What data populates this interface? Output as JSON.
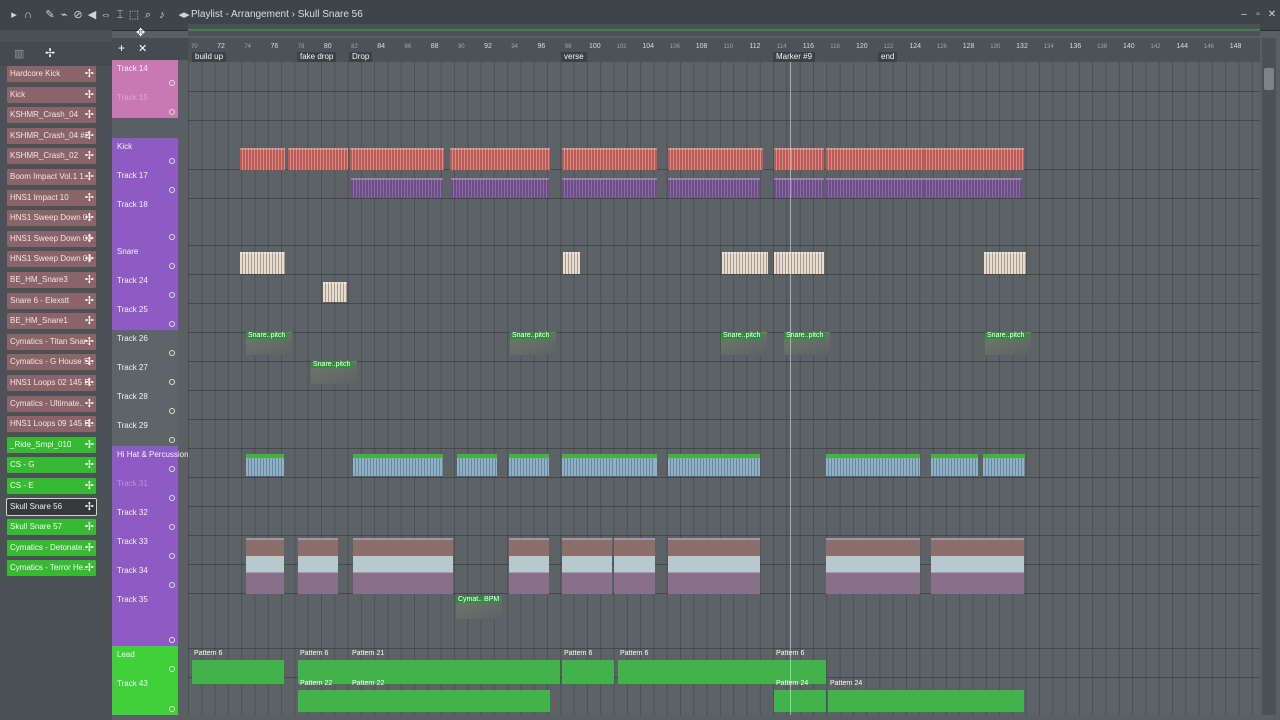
{
  "title": {
    "window": "Playlist",
    "separator": "-",
    "view": "Arrangement",
    "separator2": "›",
    "selected": "Skull Snare 56"
  },
  "colors": {
    "track_pink": "#c879b4",
    "track_purple": "#8d5bc3",
    "track_green": "#3fd03a",
    "accent_green": "#37b933"
  },
  "channels": [
    {
      "label": "Hardcore Kick",
      "color": "pink"
    },
    {
      "label": "Kick",
      "color": "pink"
    },
    {
      "label": "KSHMR_Crash_04",
      "color": "pink"
    },
    {
      "label": "KSHMR_Crash_04 #2",
      "color": "pink"
    },
    {
      "label": "KSHMR_Crash_02",
      "color": "pink"
    },
    {
      "label": "Boom Impact Vol.1 1..",
      "color": "pink"
    },
    {
      "label": "HNS1 Impact 10",
      "color": "pink"
    },
    {
      "label": "HNS1 Sweep Down 01",
      "color": "pink"
    },
    {
      "label": "HNS1 Sweep Down 03",
      "color": "pink"
    },
    {
      "label": "HNS1 Sweep Down 04",
      "color": "pink"
    },
    {
      "label": "BE_HM_Snare3",
      "color": "pink"
    },
    {
      "label": "Snare 6 - Elexstt",
      "color": "pink"
    },
    {
      "label": "BE_HM_Snare1",
      "color": "pink"
    },
    {
      "label": "Cymatics - Titan Snar..",
      "color": "pink"
    },
    {
      "label": "Cymatics - G House S..",
      "color": "pink"
    },
    {
      "label": "HNS1 Loops 02 145 B..",
      "color": "pink"
    },
    {
      "label": "Cymatics - Ultimate..",
      "color": "pink"
    },
    {
      "label": "HNS1 Loops 09 145 B..",
      "color": "pink"
    },
    {
      "label": "_Ride_Smpl_010",
      "color": "green"
    },
    {
      "label": "CS - G",
      "color": "green"
    },
    {
      "label": "CS - E",
      "color": "green"
    },
    {
      "label": "Skull Snare 56",
      "color": "sel"
    },
    {
      "label": "Skull Snare 57",
      "color": "green"
    },
    {
      "label": "Cymatics - Detonate..",
      "color": "green"
    },
    {
      "label": "Cymatics - Terror He..",
      "color": "green"
    }
  ],
  "tracks": [
    {
      "label": "Track 14",
      "color": "#c879b4"
    },
    {
      "label": "Track 15",
      "color": "#c879b4",
      "dim": true
    },
    {
      "label": "Kick",
      "color": "#8d5bc3"
    },
    {
      "label": "Track 17",
      "color": "#8d5bc3"
    },
    {
      "label": "Track 18",
      "color": "#8d5bc3"
    },
    {
      "label": "Snare",
      "color": "#8d5bc3"
    },
    {
      "label": "Track 24",
      "color": "#8d5bc3"
    },
    {
      "label": "Track 25",
      "color": "#8d5bc3"
    },
    {
      "label": "Track 26",
      "color": "#5f6468"
    },
    {
      "label": "Track 27",
      "color": "#5f6468"
    },
    {
      "label": "Track 28",
      "color": "#5f6468"
    },
    {
      "label": "Track 29",
      "color": "#5f6468"
    },
    {
      "label": "Hi Hat & Percussion",
      "color": "#8d5bc3"
    },
    {
      "label": "Track 31",
      "color": "#8d5bc3",
      "dim": true
    },
    {
      "label": "Track 32",
      "color": "#8d5bc3"
    },
    {
      "label": "Track 33",
      "color": "#8d5bc3"
    },
    {
      "label": "Track 34",
      "color": "#8d5bc3"
    },
    {
      "label": "Track 35",
      "color": "#8d5bc3"
    },
    {
      "label": "Lead",
      "color": "#3fd03a"
    },
    {
      "label": "Track 43",
      "color": "#3fd03a"
    }
  ],
  "ruler": {
    "major": [
      "72",
      "76",
      "80",
      "84",
      "88",
      "92",
      "96",
      "100",
      "104",
      "108",
      "112",
      "116",
      "120",
      "124",
      "128",
      "132",
      "136",
      "140",
      "144",
      "148"
    ],
    "minor": [
      "70",
      "74",
      "78",
      "82",
      "86",
      "90",
      "94",
      "98",
      "102",
      "106",
      "110",
      "114",
      "118",
      "122",
      "126",
      "130",
      "134",
      "138",
      "142",
      "146"
    ]
  },
  "markers": [
    {
      "label": "build up"
    },
    {
      "label": "fake drop"
    },
    {
      "label": "Drop"
    },
    {
      "label": "verse"
    },
    {
      "label": "Marker #9"
    },
    {
      "label": "end"
    }
  ],
  "automation_label": "Snare..pitch",
  "bpm_label": "Cymat.. BPM",
  "patterns": {
    "lead": [
      "Pattern 6",
      "Pattern 6",
      "Pattern 21",
      "Pattern 6",
      "Pattern 6",
      "Pattern 6"
    ],
    "track43": [
      "Pattern 22",
      "Pattern 22",
      "Pattern 24",
      "Pattern 24"
    ]
  }
}
